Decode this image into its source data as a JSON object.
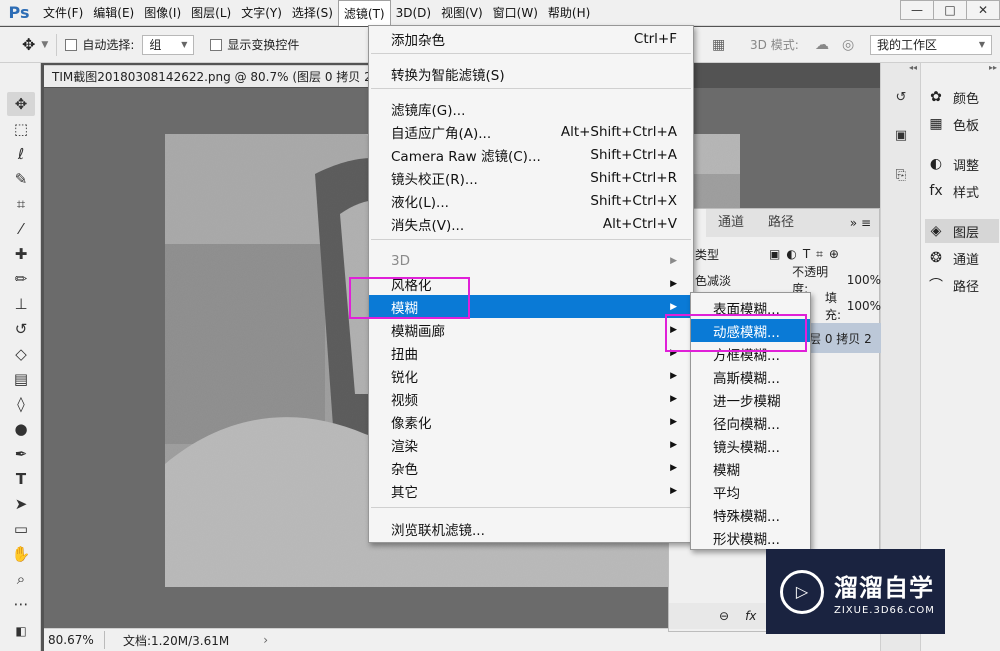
{
  "app": {
    "logo": "Ps"
  },
  "menubar": {
    "items": [
      "文件(F)",
      "编辑(E)",
      "图像(I)",
      "图层(L)",
      "文字(Y)",
      "选择(S)",
      "滤镜(T)",
      "3D(D)",
      "视图(V)",
      "窗口(W)",
      "帮助(H)"
    ],
    "active_index": 6,
    "window_controls": [
      "—",
      "□",
      "✕"
    ]
  },
  "options": {
    "auto_select_label": "自动选择:",
    "auto_select_value": "组",
    "show_transform_label": "显示变换控件",
    "mode_3d_label": "3D 模式:",
    "workspace_value": "我的工作区"
  },
  "document": {
    "tab_title": "TIM截图20180308142622.png @ 80.7% (图层 0 拷贝 2,",
    "zoom": "80.67%",
    "doc_info": "文档:1.20M/3.61M"
  },
  "filter_menu": {
    "items": [
      {
        "label": "添加杂色",
        "shortcut": "Ctrl+F"
      },
      {
        "label": "转换为智能滤镜(S)",
        "shortcut": ""
      },
      {
        "label": "滤镜库(G)...",
        "shortcut": ""
      },
      {
        "label": "自适应广角(A)...",
        "shortcut": "Alt+Shift+Ctrl+A"
      },
      {
        "label": "Camera Raw 滤镜(C)...",
        "shortcut": "Shift+Ctrl+A"
      },
      {
        "label": "镜头校正(R)...",
        "shortcut": "Shift+Ctrl+R"
      },
      {
        "label": "液化(L)...",
        "shortcut": "Shift+Ctrl+X"
      },
      {
        "label": "消失点(V)...",
        "shortcut": "Alt+Ctrl+V"
      },
      {
        "label": "3D",
        "shortcut": ""
      },
      {
        "label": "风格化",
        "shortcut": ""
      },
      {
        "label": "模糊",
        "shortcut": ""
      },
      {
        "label": "模糊画廊",
        "shortcut": ""
      },
      {
        "label": "扭曲",
        "shortcut": ""
      },
      {
        "label": "锐化",
        "shortcut": ""
      },
      {
        "label": "视频",
        "shortcut": ""
      },
      {
        "label": "像素化",
        "shortcut": ""
      },
      {
        "label": "渲染",
        "shortcut": ""
      },
      {
        "label": "杂色",
        "shortcut": ""
      },
      {
        "label": "其它",
        "shortcut": ""
      },
      {
        "label": "浏览联机滤镜...",
        "shortcut": ""
      }
    ],
    "submenu_arrow": "▶"
  },
  "blur_submenu": {
    "items": [
      "表面模糊...",
      "动感模糊...",
      "方框模糊...",
      "高斯模糊...",
      "进一步模糊",
      "径向模糊...",
      "镜头模糊...",
      "模糊",
      "平均",
      "特殊模糊...",
      "形状模糊..."
    ],
    "highlight_index": 1
  },
  "layers_panel": {
    "tabs": [
      "层",
      "通道",
      "路径"
    ],
    "filter_kind": "类型",
    "blend_mode": "色减淡",
    "opacity_label": "不透明度:",
    "opacity_value": "100%",
    "fill_label": "填充:",
    "fill_value": "100%",
    "layer_name": "层 0 拷贝 2"
  },
  "right_panel": {
    "items": [
      {
        "icon": "palette-icon",
        "label": "颜色"
      },
      {
        "icon": "swatches-icon",
        "label": "色板"
      },
      {
        "icon": "adjustments-icon",
        "label": "调整"
      },
      {
        "icon": "styles-icon",
        "label": "样式"
      },
      {
        "icon": "layers-icon",
        "label": "图层"
      },
      {
        "icon": "channels-icon",
        "label": "通道"
      },
      {
        "icon": "paths-icon",
        "label": "路径"
      }
    ],
    "selected_index": 4
  },
  "watermark": {
    "title": "溜溜自学",
    "subtitle": "ZIXUE.3D66.COM"
  },
  "colors": {
    "highlight": "#0a7ad6",
    "annotation": "#e020d8",
    "ps_blue": "#2d6db5"
  }
}
